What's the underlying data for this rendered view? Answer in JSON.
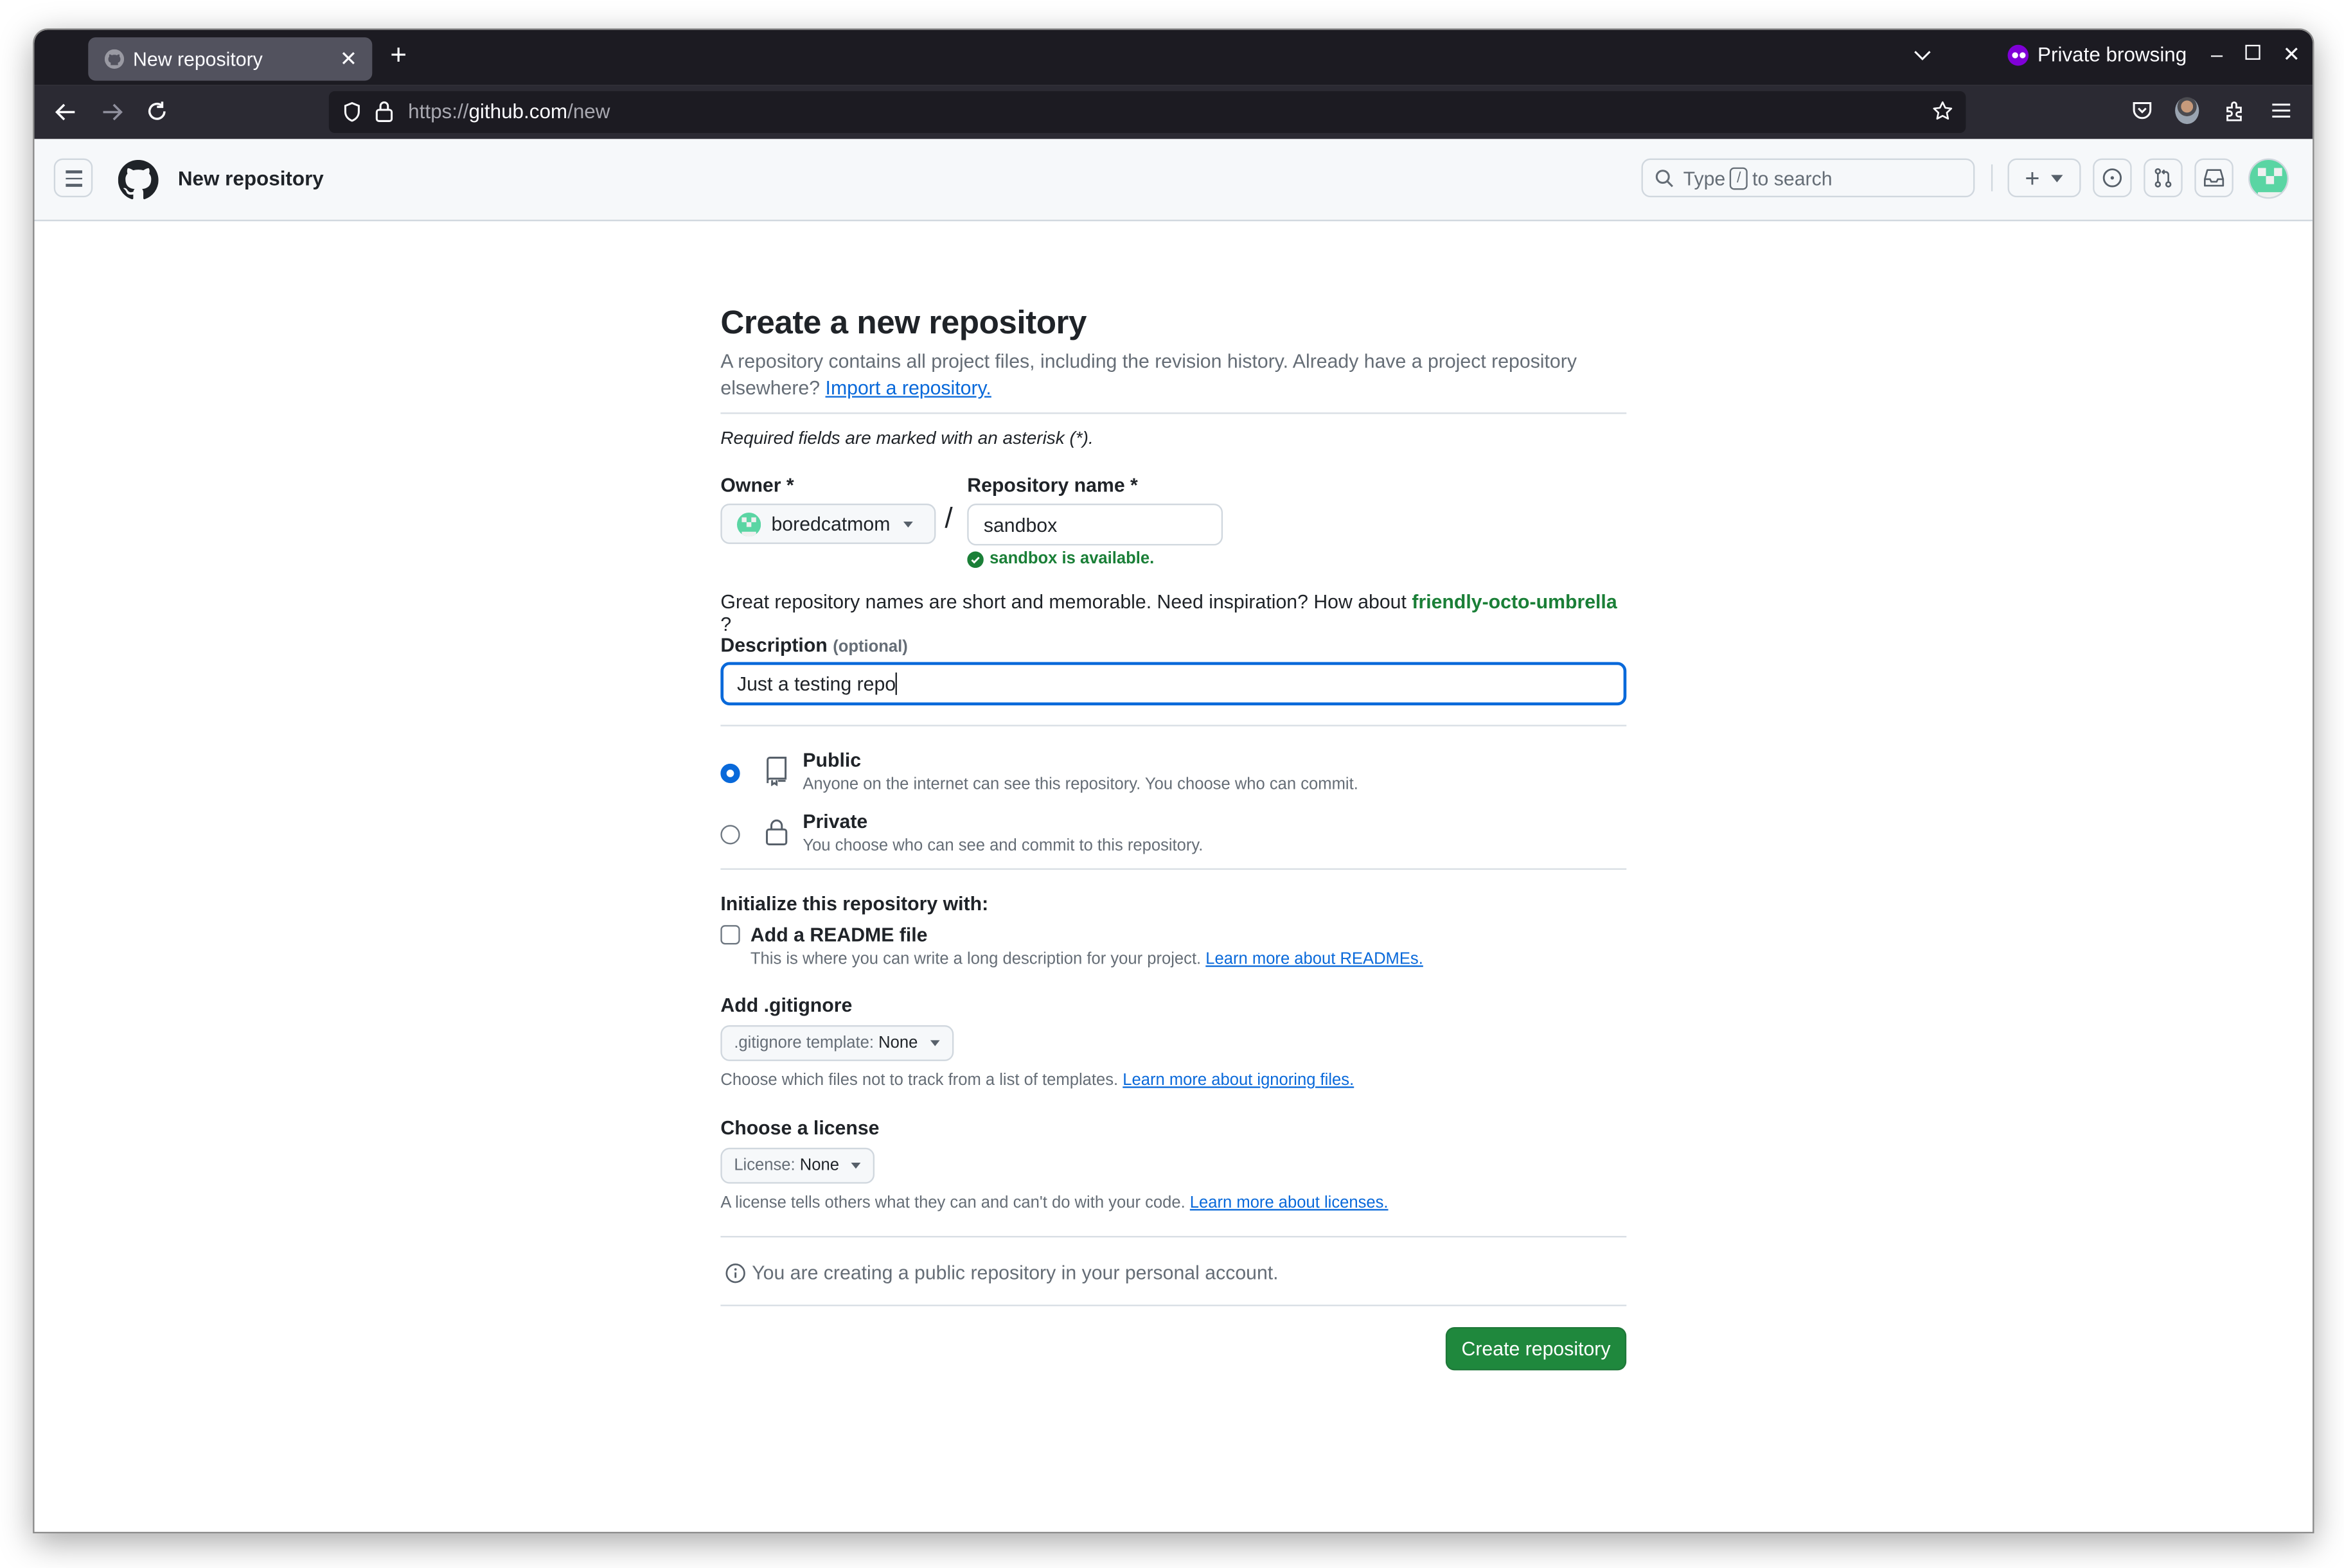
{
  "browser": {
    "tab": {
      "title": "New repository",
      "close_icon": "close-icon"
    },
    "new_tab_label": "+",
    "private_label": "Private browsing",
    "url": {
      "scheme": "https://",
      "host": "github.com",
      "path": "/new"
    },
    "window_controls": [
      "minimize",
      "maximize",
      "close"
    ]
  },
  "header": {
    "title": "New repository",
    "search": {
      "prefix": "Type",
      "key": "/",
      "suffix": "to search"
    },
    "create_label": "+",
    "avatar_color": "#5ad5a3"
  },
  "form": {
    "title": "Create a new repository",
    "lead": "A repository contains all project files, including the revision history. Already have a project repository elsewhere?",
    "import_link": "Import a repository.",
    "required_note": "Required fields are marked with an asterisk (*).",
    "owner": {
      "label": "Owner *",
      "value": "boredcatmom"
    },
    "separator": "/",
    "repo_name": {
      "label": "Repository name *",
      "value": "sandbox",
      "available": "sandbox is available."
    },
    "inspiration": {
      "text": "Great repository names are short and memorable. Need inspiration? How about",
      "suggestion": "friendly-octo-umbrella",
      "suffix": "?"
    },
    "description": {
      "label": "Description",
      "optional": "(optional)",
      "value": "Just a testing repo"
    },
    "visibility": [
      {
        "title": "Public",
        "desc": "Anyone on the internet can see this repository. You choose who can commit.",
        "selected": true
      },
      {
        "title": "Private",
        "desc": "You choose who can see and commit to this repository.",
        "selected": false
      }
    ],
    "init": {
      "heading": "Initialize this repository with:",
      "readme": {
        "label": "Add a README file",
        "checked": false,
        "desc": "This is where you can write a long description for your project.",
        "link": "Learn more about READMEs."
      }
    },
    "gitignore": {
      "heading": "Add .gitignore",
      "prefix": ".gitignore template:",
      "value": "None",
      "desc": "Choose which files not to track from a list of templates.",
      "link": "Learn more about ignoring files."
    },
    "license": {
      "heading": "Choose a license",
      "prefix": "License:",
      "value": "None",
      "desc": "A license tells others what they can and can't do with your code.",
      "link": "Learn more about licenses."
    },
    "notice": "You are creating a public repository in your personal account.",
    "submit": "Create repository"
  },
  "colors": {
    "accent": "#0969da",
    "success": "#1a7f37",
    "primary_button": "#1f883d",
    "private_purple": "#8000d7"
  }
}
